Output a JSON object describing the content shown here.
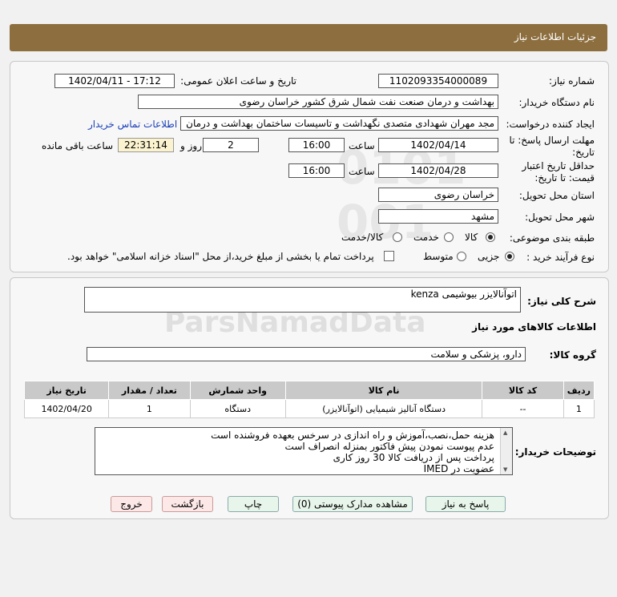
{
  "header": {
    "title": "جزئیات اطلاعات نیاز"
  },
  "form": {
    "need_number_label": "شماره نیاز:",
    "need_number": "1102093354000089",
    "announce_label": "تاریخ و ساعت اعلان عمومی:",
    "announce_value": "1402/04/11 - 17:12",
    "buyer_label": "نام دستگاه خریدار:",
    "buyer_value": "بهداشت و درمان صنعت نفت شمال شرق کشور   خراسان رضوی",
    "creator_label": "ایجاد کننده درخواست:",
    "creator_value": "مجد مهران شهدادی متصدی نگهداشت و تاسیسات ساختمان بهداشت و درمان",
    "contact_link": "اطلاعات تماس خریدار",
    "deadline_label_1": "مهلت ارسال پاسخ: تا",
    "deadline_label_2": "تاریخ:",
    "deadline_date": "1402/04/14",
    "time_label": "ساعت",
    "deadline_time": "16:00",
    "days_value": "2",
    "days_label": "روز و",
    "remaining_time": "22:31:14",
    "remaining_label": "ساعت باقی مانده",
    "validity_label_1": "حداقل تاریخ اعتبار",
    "validity_label_2": "قیمت: تا تاریخ:",
    "validity_date": "1402/04/28",
    "validity_time": "16:00",
    "province_label": "استان محل تحویل:",
    "province_value": "خراسان رضوی",
    "city_label": "شهر محل تحویل:",
    "city_value": "مشهد",
    "category_label": "طبقه بندی موضوعی:",
    "category_options": [
      "کالا",
      "خدمت",
      "کالا/خدمت"
    ],
    "category_selected": 0,
    "process_label": "نوع فرآیند خرید :",
    "process_options": [
      "جزیی",
      "متوسط"
    ],
    "process_selected": 0,
    "payment_note": "پرداخت تمام یا بخشی از مبلغ خرید،از محل \"اسناد خزانه اسلامی\" خواهد بود."
  },
  "details": {
    "desc_label": "شرح کلی نیاز:",
    "desc_value": "اتوآنالایزر بیوشیمی kenza",
    "goods_title": "اطلاعات کالاهای مورد نیاز",
    "group_label": "گروه کالا:",
    "group_value": "دارو، پزشکی و سلامت",
    "table_headers": [
      "ردیف",
      "کد کالا",
      "نام کالا",
      "واحد شمارش",
      "تعداد / مقدار",
      "تاریخ نیاز"
    ],
    "table_rows": [
      [
        "1",
        "--",
        "دستگاه آنالیز شیمیایی (اتوآنالایزر)",
        "دستگاه",
        "1",
        "1402/04/20"
      ]
    ],
    "notes_label": "توضیحات خریدار:",
    "notes_lines": [
      "هزینه حمل،نصب،آموزش و راه اندازی در سرخس بعهده فروشنده است",
      "عدم پیوست نمودن پیش فاکتور بمنزله انصراف است",
      "پرداخت پس از دریافت کالا  30 روز کاری",
      "عضویت در IMED"
    ]
  },
  "buttons": {
    "reply": "پاسخ به نیاز",
    "attachments": "مشاهده مدارک پیوستی (0)",
    "print": "چاپ",
    "back": "بازگشت",
    "exit": "خروج"
  }
}
